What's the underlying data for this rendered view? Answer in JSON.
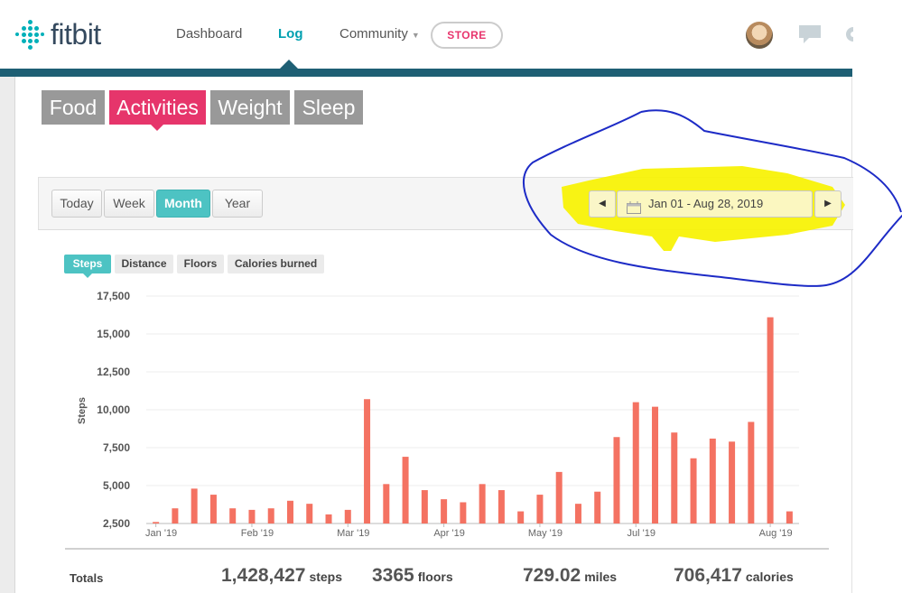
{
  "brand": {
    "name": "fitbit"
  },
  "nav": {
    "items": [
      {
        "label": "Dashboard"
      },
      {
        "label": "Log"
      },
      {
        "label": "Community"
      }
    ],
    "store_label": "STORE",
    "icons": [
      "chat-icon",
      "gear-icon"
    ]
  },
  "categories": [
    "Food",
    "Activities",
    "Weight",
    "Sleep"
  ],
  "active_category": "Activities",
  "periods": [
    "Today",
    "Week",
    "Month",
    "Year"
  ],
  "active_period": "Month",
  "date_range": {
    "label": "Jan 01 - Aug 28, 2019",
    "prev_icon": "triangle-left-icon",
    "next_icon": "triangle-right-icon"
  },
  "metrics": [
    "Steps",
    "Distance",
    "Floors",
    "Calories burned"
  ],
  "active_metric": "Steps",
  "chart_data": {
    "type": "bar",
    "ylabel": "Steps",
    "ylim": [
      2500,
      17500
    ],
    "yticks": [
      "2,500",
      "5,000",
      "7,500",
      "10,000",
      "12,500",
      "15,000",
      "17,500"
    ],
    "ytick_values": [
      2500,
      5000,
      7500,
      10000,
      12500,
      15000,
      17500
    ],
    "xticks": [
      {
        "label": "Jan '19",
        "index": 0
      },
      {
        "label": "Feb '19",
        "index": 5
      },
      {
        "label": "Mar '19",
        "index": 10
      },
      {
        "label": "Apr '19",
        "index": 15
      },
      {
        "label": "May '19",
        "index": 20
      },
      {
        "label": "Jul '19",
        "index": 25
      },
      {
        "label": "Aug '19",
        "index": 32
      }
    ],
    "values": [
      2600,
      3500,
      4800,
      4400,
      3500,
      3400,
      3500,
      4000,
      3800,
      3100,
      3400,
      10700,
      5100,
      6900,
      4700,
      4100,
      3900,
      5100,
      4700,
      3300,
      4400,
      5900,
      3800,
      4600,
      8200,
      10500,
      10200,
      8500,
      6800,
      8100,
      7900,
      9200,
      16100,
      3300
    ],
    "bar_color": "#f47262",
    "grid": true
  },
  "totals": {
    "label": "Totals",
    "steps": {
      "value": "1,428,427",
      "unit": "steps"
    },
    "floors": {
      "value": "3365",
      "unit": "floors"
    },
    "miles": {
      "value": "729.02",
      "unit": "miles"
    },
    "calories": {
      "value": "706,417",
      "unit": "calories"
    }
  }
}
